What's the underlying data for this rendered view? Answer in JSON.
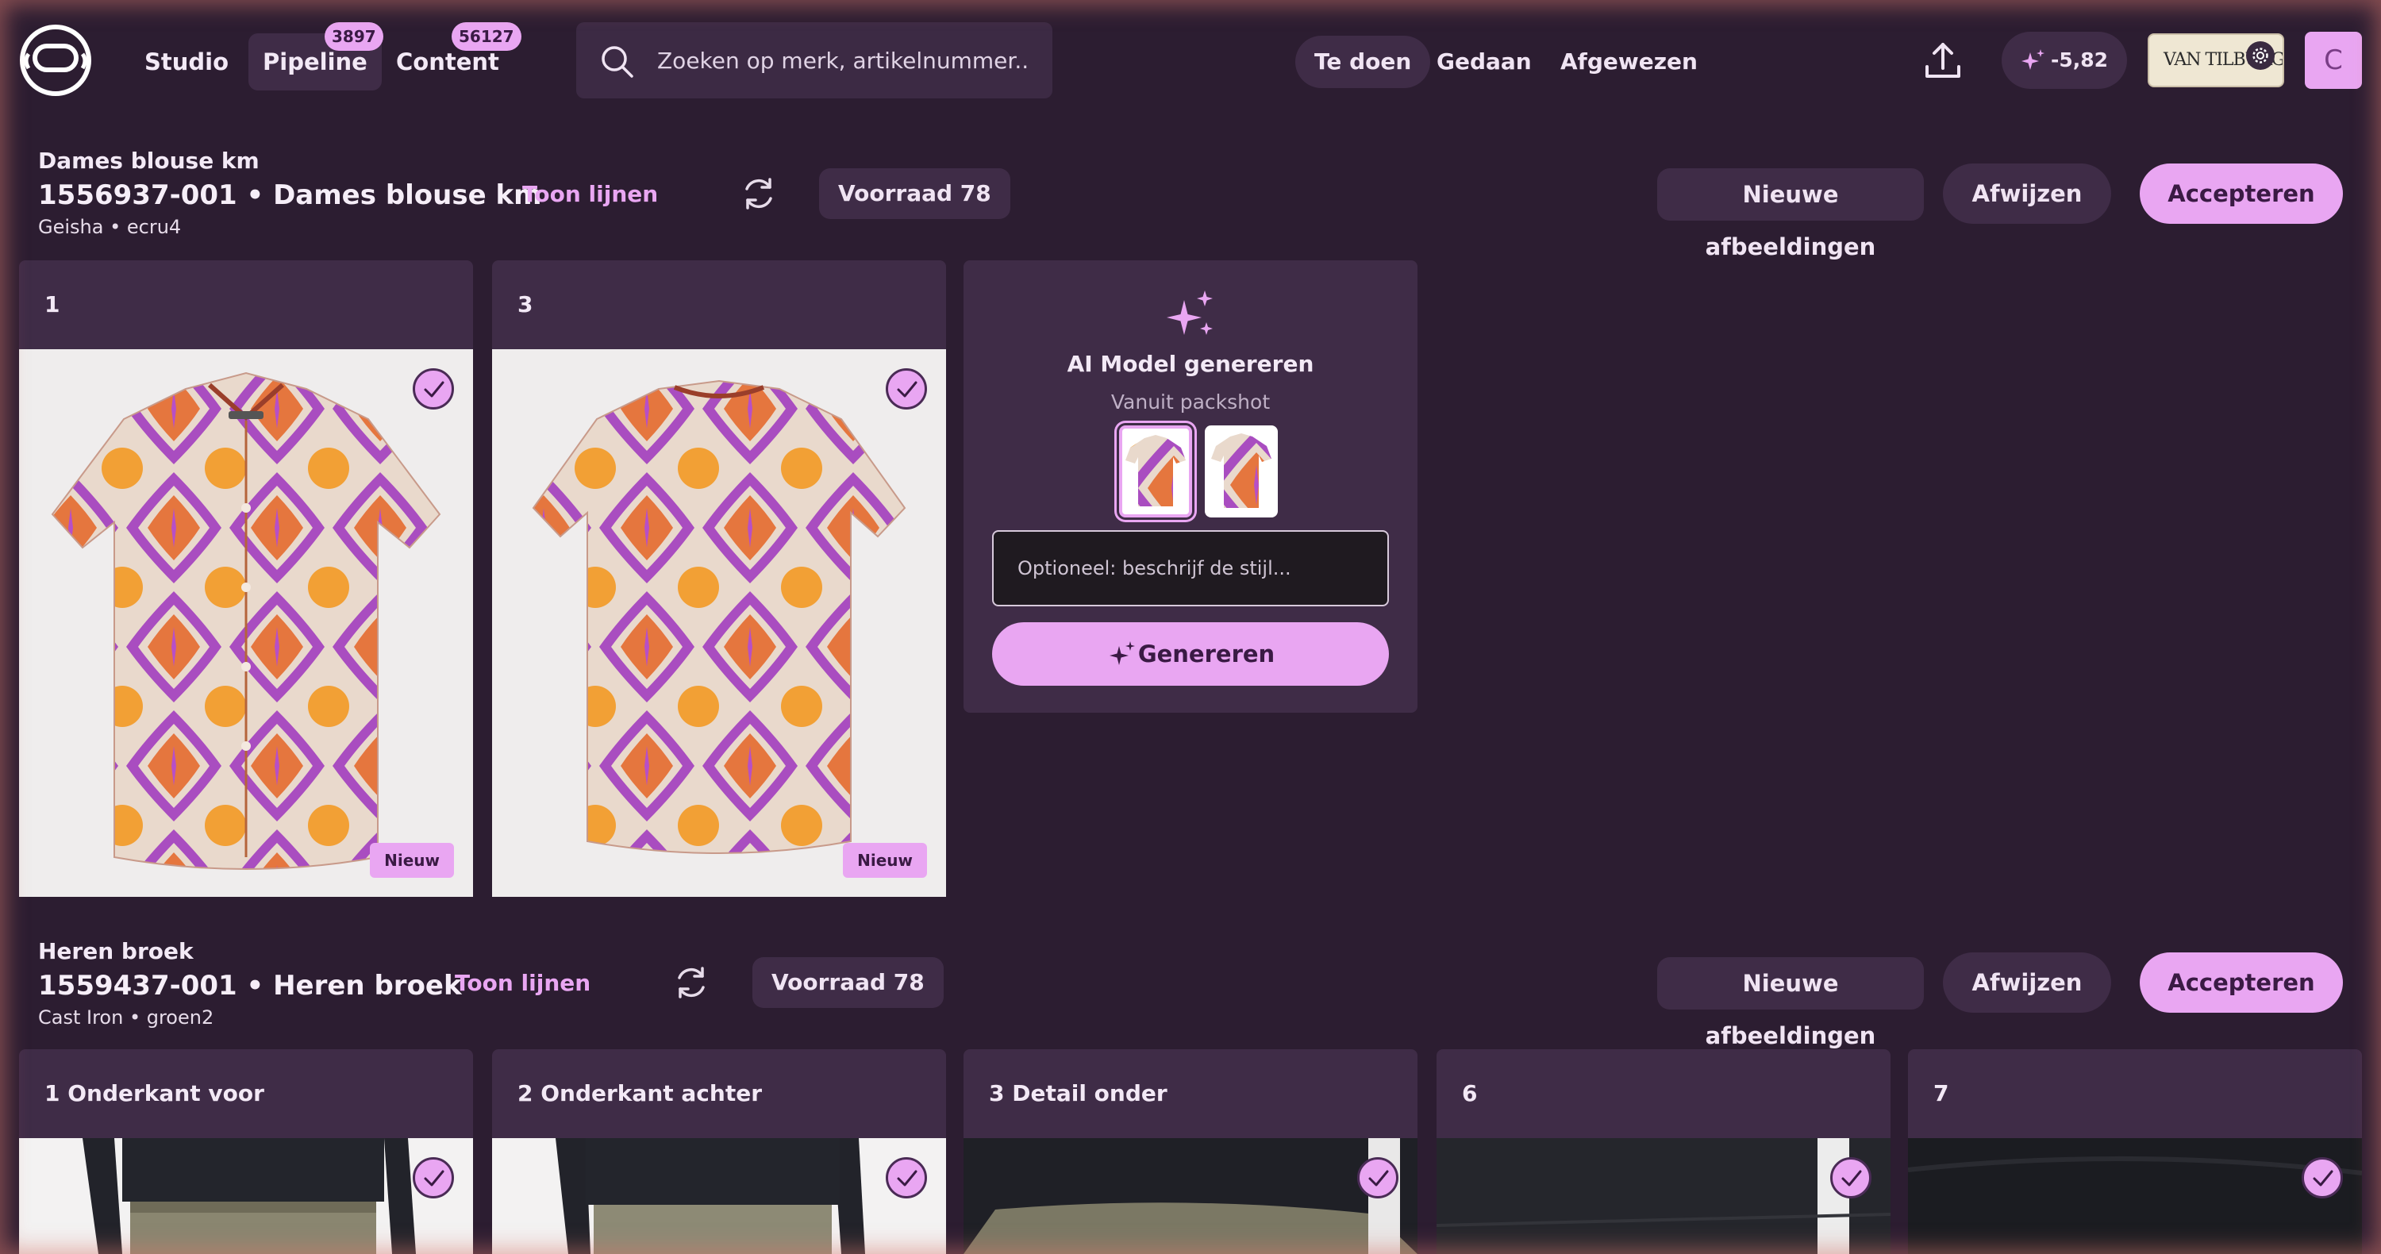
{
  "nav": {
    "studio": "Studio",
    "pipeline": "Pipeline",
    "pipeline_count": "3897",
    "content": "Content",
    "content_count": "56127"
  },
  "search": {
    "placeholder": "Zoeken op merk, artikelnummer.."
  },
  "filters": {
    "todo": "Te doen",
    "done": "Gedaan",
    "rejected": "Afgewezen"
  },
  "credits": "-5,82",
  "brand": "VAN TILBURG",
  "avatar_initial": "C",
  "articles": [
    {
      "category": "Dames blouse km",
      "title": "1556937-001 • Dames blouse km",
      "subtitle": "Geisha • ecru4",
      "show_lines": "Toon lijnen",
      "stock": "Voorraad 78",
      "btn_new_images": "Nieuwe afbeeldingen",
      "btn_reject": "Afwijzen",
      "btn_accept": "Accepteren",
      "cards": [
        {
          "label": "1",
          "badge": "Nieuw"
        },
        {
          "label": "3",
          "badge": "Nieuw"
        }
      ]
    },
    {
      "category": "Heren broek",
      "title": "1559437-001 • Heren broek",
      "subtitle": "Cast Iron • groen2",
      "show_lines": "Toon lijnen",
      "stock": "Voorraad 78",
      "btn_new_images": "Nieuwe afbeeldingen",
      "btn_reject": "Afwijzen",
      "btn_accept": "Accepteren",
      "cards": [
        {
          "label": "1 Onderkant voor"
        },
        {
          "label": "2 Onderkant achter"
        },
        {
          "label": "3 Detail onder"
        },
        {
          "label": "6"
        },
        {
          "label": "7"
        }
      ]
    }
  ],
  "ai_panel": {
    "title": "AI Model genereren",
    "subtitle": "Vanuit packshot",
    "input_placeholder": "Optioneel: beschrijf de stijl...",
    "generate": "Genereren"
  },
  "colors": {
    "background": "#2c1d31",
    "surface": "#3f2c47",
    "accent": "#e9a6f2",
    "text_accent": "#3a1a44"
  }
}
